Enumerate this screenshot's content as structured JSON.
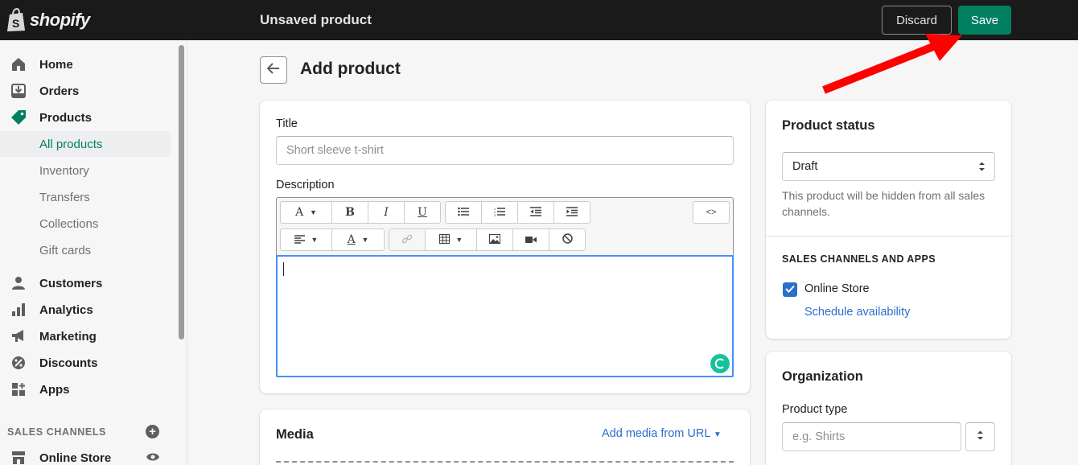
{
  "brand": {
    "name": "shopify"
  },
  "topbar": {
    "title": "Unsaved product",
    "discard_label": "Discard",
    "save_label": "Save",
    "save_color": "#008060"
  },
  "sidebar": {
    "items": [
      {
        "label": "Home",
        "icon": "home-icon"
      },
      {
        "label": "Orders",
        "icon": "orders-icon"
      },
      {
        "label": "Products",
        "icon": "tag-icon"
      },
      {
        "label": "All products"
      },
      {
        "label": "Inventory"
      },
      {
        "label": "Transfers"
      },
      {
        "label": "Collections"
      },
      {
        "label": "Gift cards"
      },
      {
        "label": "Customers",
        "icon": "person-icon"
      },
      {
        "label": "Analytics",
        "icon": "bar-chart-icon"
      },
      {
        "label": "Marketing",
        "icon": "megaphone-icon"
      },
      {
        "label": "Discounts",
        "icon": "discount-icon"
      },
      {
        "label": "Apps",
        "icon": "apps-icon"
      }
    ],
    "sales_channels_heading": "SALES CHANNELS",
    "online_store_label": "Online Store"
  },
  "page": {
    "title": "Add product"
  },
  "product_card": {
    "title_label": "Title",
    "title_placeholder": "Short sleeve t-shirt",
    "description_label": "Description",
    "html_toggle": "<>"
  },
  "media_card": {
    "title": "Media",
    "add_from_url": "Add media from URL"
  },
  "status_card": {
    "title": "Product status",
    "status_value": "Draft",
    "help": "This product will be hidden from all sales channels.",
    "channels_heading": "SALES CHANNELS AND APPS",
    "online_store": "Online Store",
    "online_store_checked": true,
    "schedule_link": "Schedule availability"
  },
  "organization_card": {
    "title": "Organization",
    "product_type_label": "Product type",
    "product_type_placeholder": "e.g. Shirts"
  },
  "colors": {
    "accent_green": "#008060",
    "link_blue": "#2c6ecb",
    "annotation_red": "#ff0000"
  }
}
